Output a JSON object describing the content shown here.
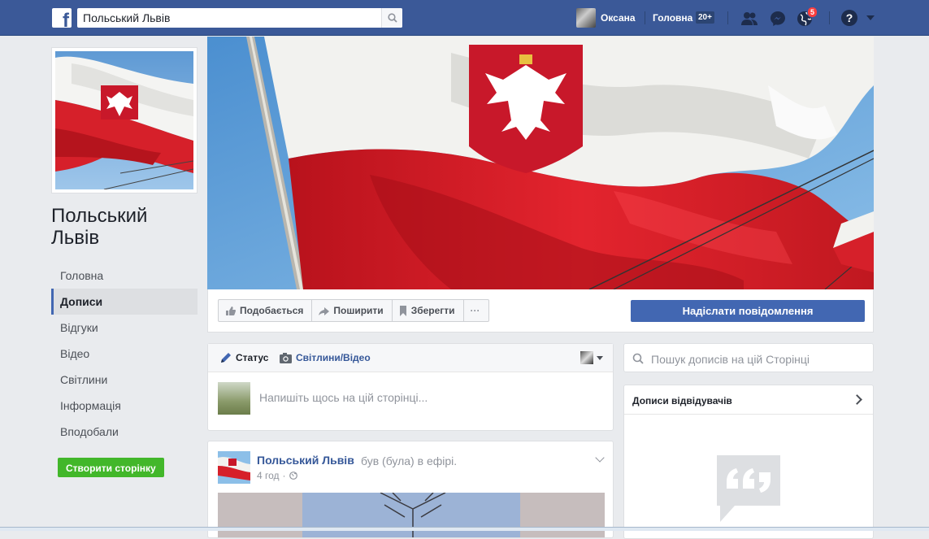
{
  "topbar": {
    "search_value": "Польський Львів",
    "user_name": "Оксана",
    "home_label": "Головна",
    "home_badge": "20+",
    "notifications_count": "5",
    "help_label": "?"
  },
  "page": {
    "name": "Польський Львів"
  },
  "left_nav": {
    "items": [
      "Головна",
      "Дописи",
      "Відгуки",
      "Відео",
      "Світлини",
      "Інформація",
      "Вподобали"
    ],
    "active_index": 1,
    "create_page_label": "Створити сторінку"
  },
  "actions": {
    "like_label": "Подобається",
    "share_label": "Поширити",
    "save_label": "Зберегти",
    "more_label": "···",
    "send_message_label": "Надіслати повідомлення"
  },
  "composer": {
    "tab_status": "Статус",
    "tab_photo": "Світлини/Відео",
    "placeholder": "Напишіть щось на цій сторінці..."
  },
  "post": {
    "author": "Польський Львів",
    "action": "був (була) в ефірі.",
    "time": "4 год",
    "separator": "·"
  },
  "right": {
    "search_placeholder": "Пошук дописів на цій Сторінці",
    "visitor_posts_title": "Дописи відвідувачів"
  },
  "colors": {
    "brand": "#3b5998",
    "button_blue": "#4267b2",
    "green": "#42b72a",
    "notif_red": "#fa3e3e",
    "flag_red": "#d6202a"
  }
}
